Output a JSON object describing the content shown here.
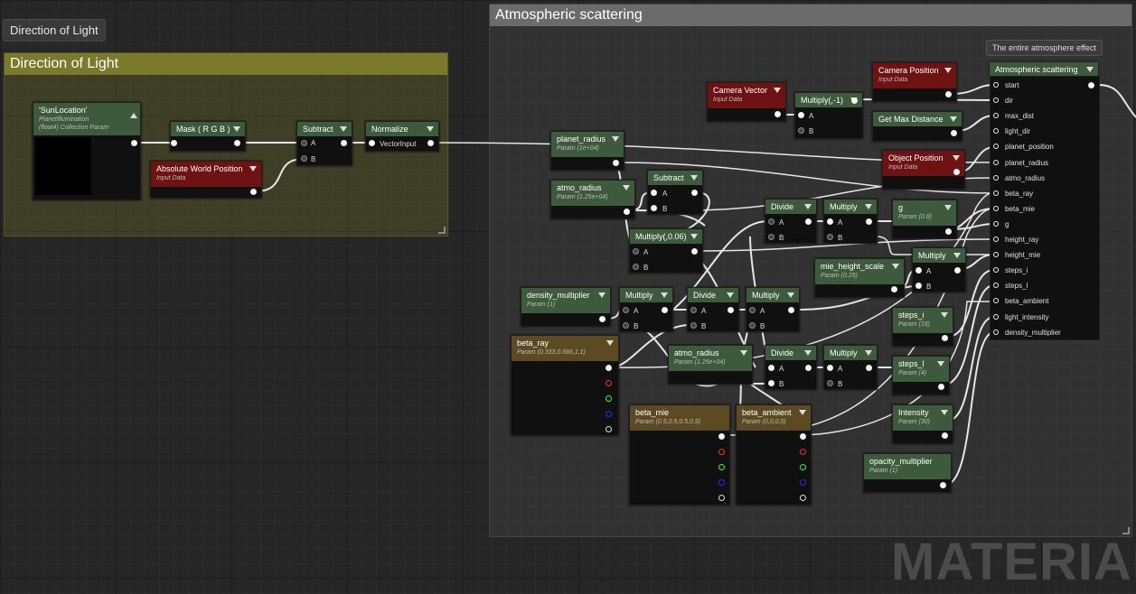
{
  "tooltip": "Direction of Light",
  "comments": {
    "direction": "Direction of Light",
    "atmo": "Atmospheric scattering"
  },
  "bubble": "The entire atmosphere effect",
  "watermark": "MATERIAL",
  "nodes": {
    "sun": {
      "title": "'SunLocation'",
      "sub1": "PlanetIllumination",
      "sub2": "(float4) Collection Param"
    },
    "mask": {
      "title": "Mask ( R G B )"
    },
    "subtract1": {
      "title": "Subtract",
      "a": "A",
      "b": "B"
    },
    "normalize": {
      "title": "Normalize",
      "in": "VectorInput"
    },
    "absworld": {
      "title": "Absolute World Position",
      "sub": "Input Data"
    },
    "planet_radius": {
      "title": "planet_radius",
      "sub": "Param (1e+04)"
    },
    "atmo_radius": {
      "title": "atmo_radius",
      "sub": "Param (1.25e+04)"
    },
    "subtract2": {
      "title": "Subtract",
      "a": "A",
      "b": "B"
    },
    "camvec": {
      "title": "Camera Vector",
      "sub": "Input Data"
    },
    "mult_neg1": {
      "title": "Multiply(,-1)",
      "a": "A",
      "b": "B"
    },
    "campos": {
      "title": "Camera Position",
      "sub": "Input Data"
    },
    "getmax": {
      "title": "Get Max Distance"
    },
    "objpos": {
      "title": "Object Position",
      "sub": "Input Data"
    },
    "divide1": {
      "title": "Divide",
      "a": "A",
      "b": "B"
    },
    "mult1": {
      "title": "Multiply",
      "a": "A",
      "b": "B"
    },
    "g": {
      "title": "g",
      "sub": "Param (0.8)"
    },
    "mult006": {
      "title": "Multiply(,0.06)",
      "a": "A",
      "b": "B"
    },
    "mult2": {
      "title": "Multiply",
      "a": "A",
      "b": "B"
    },
    "mie_hs": {
      "title": "mie_height_scale",
      "sub": "Param (0.25)"
    },
    "density": {
      "title": "density_multiplier",
      "sub": "Param (1)"
    },
    "mult3": {
      "title": "Multiply",
      "a": "A",
      "b": "B"
    },
    "divide2": {
      "title": "Divide",
      "a": "A",
      "b": "B"
    },
    "mult4": {
      "title": "Multiply",
      "a": "A",
      "b": "B"
    },
    "steps_i": {
      "title": "steps_i",
      "sub": "Param (16)"
    },
    "beta_ray": {
      "title": "beta_ray",
      "sub": "Param (0.333,0.666,1,1)"
    },
    "atmo_radius2": {
      "title": "atmo_radius",
      "sub": "Param (1.25e+04)"
    },
    "divide3": {
      "title": "Divide",
      "a": "A",
      "b": "B"
    },
    "mult5": {
      "title": "Multiply",
      "a": "A",
      "b": "B"
    },
    "steps_l": {
      "title": "steps_l",
      "sub": "Param (4)"
    },
    "beta_mie": {
      "title": "beta_mie",
      "sub": "Param (0.5,0.5,0.5,0.5)"
    },
    "beta_ambient": {
      "title": "beta_ambient",
      "sub": "Param (0,0,0,0)"
    },
    "intensity": {
      "title": "Intensity",
      "sub": "Param (30)"
    },
    "opacity": {
      "title": "opacity_multiplier",
      "sub": "Param (1)"
    },
    "atmos": {
      "title": "Atmospheric scattering",
      "inputs": [
        "start",
        "dir",
        "max_dist",
        "light_dir",
        "planet_position",
        "planet_radius",
        "atmo_radius",
        "beta_ray",
        "beta_mie",
        "g",
        "height_ray",
        "height_mie",
        "steps_i",
        "steps_l",
        "beta_ambient",
        "light_intensity",
        "density_multiplier"
      ]
    }
  }
}
